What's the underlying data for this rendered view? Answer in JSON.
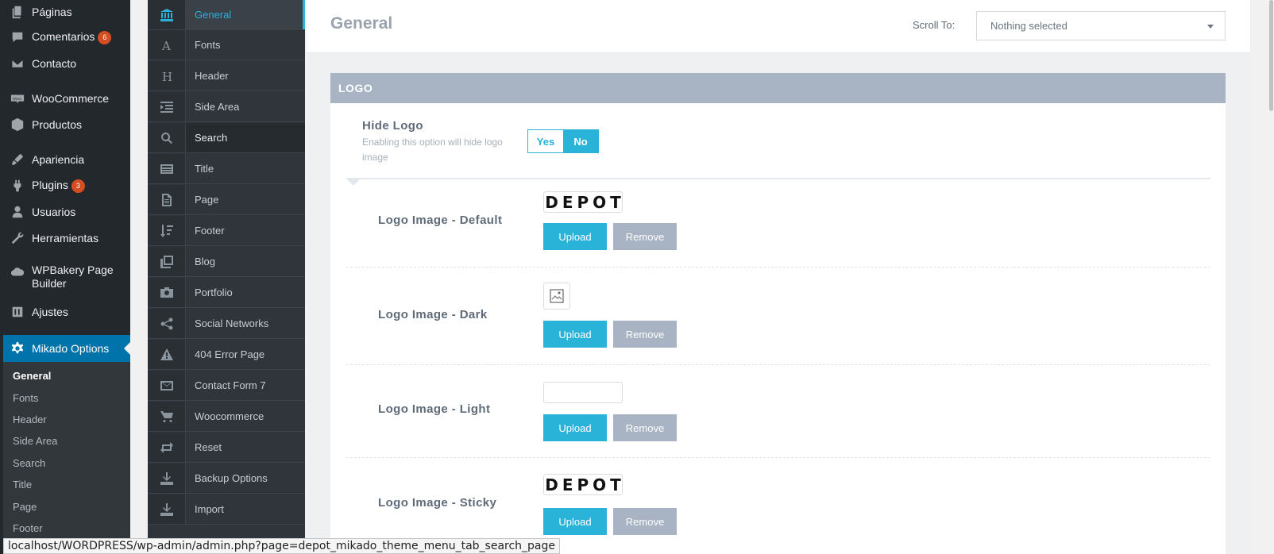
{
  "wp_menu": {
    "items": [
      {
        "label": "Páginas",
        "icon": "pages-icon"
      },
      {
        "label": "Comentarios",
        "icon": "comments-icon",
        "badge": "6"
      },
      {
        "label": "Contacto",
        "icon": "mail-icon"
      },
      {
        "label": "WooCommerce",
        "icon": "woocommerce-icon"
      },
      {
        "label": "Productos",
        "icon": "box-icon"
      },
      {
        "label": "Apariencia",
        "icon": "brush-icon"
      },
      {
        "label": "Plugins",
        "icon": "plugin-icon",
        "badge": "3"
      },
      {
        "label": "Usuarios",
        "icon": "user-icon"
      },
      {
        "label": "Herramientas",
        "icon": "wrench-icon"
      },
      {
        "label": "WPBakery Page Builder",
        "icon": "cloud-icon"
      },
      {
        "label": "Ajustes",
        "icon": "settings-icon"
      },
      {
        "label": "Mikado Options",
        "icon": "gear-icon"
      }
    ],
    "submenu": [
      "General",
      "Fonts",
      "Header",
      "Side Area",
      "Search",
      "Title",
      "Page",
      "Footer"
    ]
  },
  "mikado_nav": [
    {
      "label": "General",
      "icon": "bank-icon"
    },
    {
      "label": "Fonts",
      "icon": "font-icon"
    },
    {
      "label": "Header",
      "icon": "header-icon"
    },
    {
      "label": "Side Area",
      "icon": "indent-icon"
    },
    {
      "label": "Search",
      "icon": "search-icon"
    },
    {
      "label": "Title",
      "icon": "title-icon"
    },
    {
      "label": "Page",
      "icon": "page-icon"
    },
    {
      "label": "Footer",
      "icon": "footer-icon"
    },
    {
      "label": "Blog",
      "icon": "blog-icon"
    },
    {
      "label": "Portfolio",
      "icon": "portfolio-icon"
    },
    {
      "label": "Social Networks",
      "icon": "share-icon"
    },
    {
      "label": "404 Error Page",
      "icon": "warning-icon"
    },
    {
      "label": "Contact Form 7",
      "icon": "envelope-icon"
    },
    {
      "label": "Woocommerce",
      "icon": "cart-icon"
    },
    {
      "label": "Reset",
      "icon": "reset-icon"
    },
    {
      "label": "Backup Options",
      "icon": "download-icon"
    },
    {
      "label": "Import",
      "icon": "import-icon"
    }
  ],
  "header": {
    "title": "General",
    "scroll_label": "Scroll To:",
    "scroll_value": "Nothing selected"
  },
  "section": {
    "title": "LOGO",
    "hide_logo": {
      "title": "Hide Logo",
      "desc": "Enabling this option will hide logo image",
      "yes": "Yes",
      "no": "No",
      "selected": "No"
    },
    "logo_options": [
      {
        "title": "Logo Image - Default",
        "preview": "DEPOT"
      },
      {
        "title": "Logo Image - Dark",
        "preview": ""
      },
      {
        "title": "Logo Image - Light",
        "preview": ""
      },
      {
        "title": "Logo Image - Sticky",
        "preview": "DEPOT"
      }
    ],
    "upload_label": "Upload",
    "remove_label": "Remove"
  },
  "status_url": "localhost/WORDPRESS/wp-admin/admin.php?page=depot_mikado_theme_menu_tab_search_page"
}
